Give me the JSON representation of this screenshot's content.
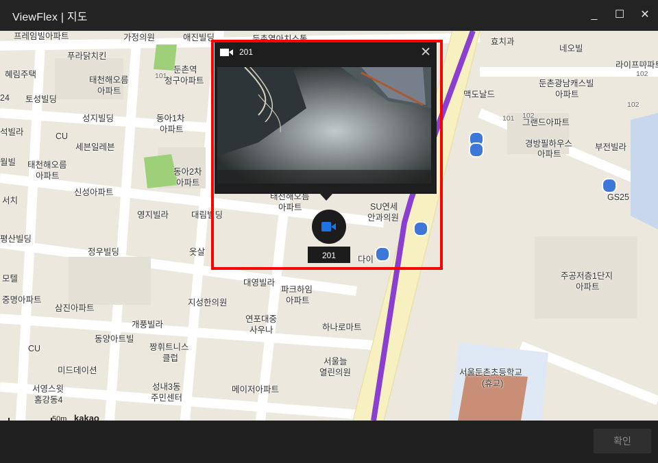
{
  "window": {
    "title": "ViewFlex  |  지도",
    "minimize": "_",
    "maximize": "☐",
    "close": "✕"
  },
  "map": {
    "labels": [
      "프레임빌아파트",
      "가정의원",
      "애진빌딩",
      "둔촌열아치스톨",
      "효치과",
      "네오빌",
      "라이프아파트",
      "푸라닭치킨",
      "혜림주택",
      "태천해오름",
      "아파트",
      "둔촌역",
      "청구아파트",
      "맥도날드",
      "둔촌광남캐스빌",
      "아파트",
      "24",
      "토성빌딩",
      "성지빌딩",
      "동아1차",
      "아파트",
      "그랜드아파트",
      "석빌라",
      "CU",
      "세븐일레븐",
      "경방필하우스",
      "아파트",
      "부전빌라",
      "월빌",
      "태천해오름",
      "아파트",
      "동아2차",
      "아파트",
      "GS25",
      "서치",
      "신성아파트",
      "영지빌라",
      "대림빌딩",
      "평산빌딩",
      "정우빌딩",
      "옷살",
      "모텔",
      "중명아파트",
      "삼진아파트",
      "대영빌라",
      "파크하임",
      "아파트",
      "지성한의원",
      "주공저층1단지",
      "아파트",
      "개풍빌라",
      "동양아트빌",
      "연포대중",
      "사우나",
      "하나로마트",
      "CU",
      "짱휘트니스",
      "클럽",
      "미드데이션",
      "서울늘",
      "열린의원",
      "서울둔촌초등학교",
      "(휴교)",
      "성내3동",
      "주민센터",
      "서영스윗",
      "홈강동4",
      "메이저아파트",
      "태천해오름",
      "아파트",
      "SU연세",
      "안과의원",
      "다이",
      "102",
      "101",
      "101",
      "102",
      "102",
      "101"
    ],
    "scale_text": "50m",
    "provider": "kakao"
  },
  "camera_popup": {
    "camera_name": "201",
    "close_label": "✕",
    "icon": "video-camera-icon"
  },
  "camera_marker": {
    "label": "201",
    "icon": "video-camera-icon",
    "icon_color": "#1e73e8"
  },
  "footer": {
    "confirm_label": "확인"
  },
  "colors": {
    "highlight_border": "#ff0000",
    "subway_line": "#8a3fd1",
    "road_yellow": "#f7f0c0",
    "park_green": "#9ed07a"
  }
}
